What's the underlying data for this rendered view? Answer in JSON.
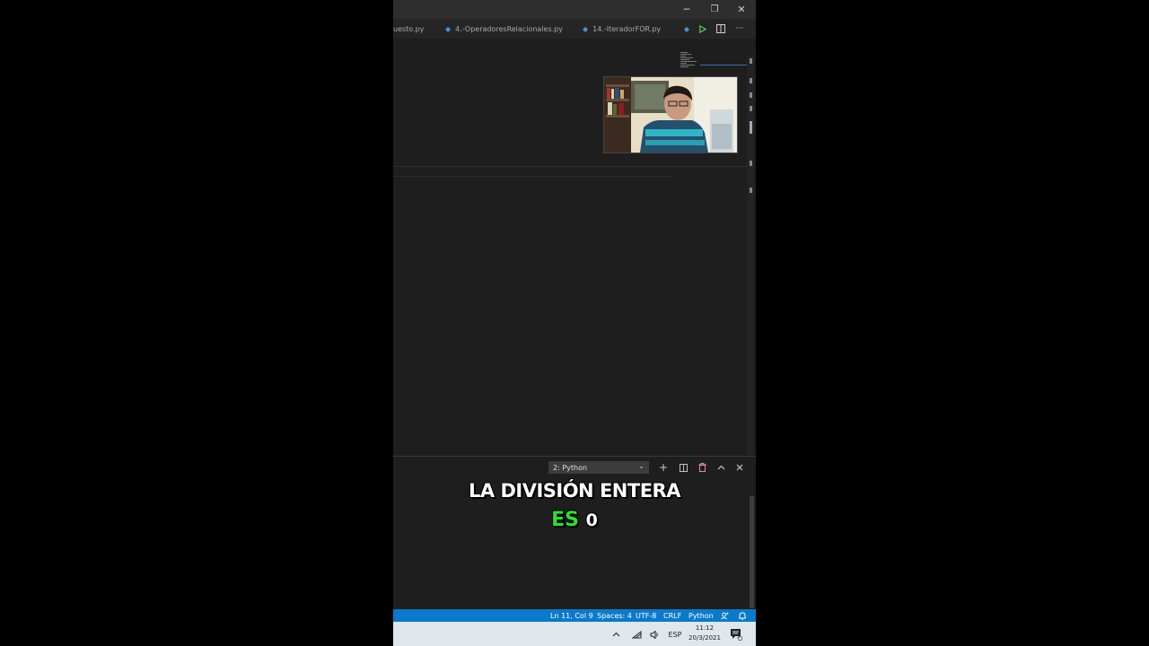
{
  "window": {
    "minimize_glyph": "─",
    "restore_glyph": "❐",
    "close_glyph": "✕"
  },
  "tabs": [
    {
      "label": "uesto.py"
    },
    {
      "label": "4.-OperadoresRelacionales.py"
    },
    {
      "label": "14.-IteradorFOR.py"
    }
  ],
  "toolbar": {
    "icons": [
      "python-file-icon",
      "run-icon",
      "split-editor-icon",
      "more-icon"
    ],
    "more_glyph": "···"
  },
  "panel": {
    "terminal_selected": "2: Python",
    "icons": [
      "add-terminal-icon",
      "split-terminal-icon",
      "trash-icon",
      "maximize-icon",
      "close-icon"
    ]
  },
  "captions": {
    "line1": "LA DIVISIÓN ENTERA",
    "line2_highlight": "ES",
    "line2_rest": "0"
  },
  "status": {
    "position": "Ln 11, Col 9",
    "spaces": "Spaces: 4",
    "encoding": "UTF-8",
    "eol": "CRLF",
    "language": "Python"
  },
  "taskbar": {
    "input_language": "ESP",
    "time": "11:12",
    "date": "20/3/2021",
    "notification_count": "5"
  },
  "colors": {
    "status_bar": "#0a7acc",
    "caption_highlight": "#2fe02f",
    "python_icon": "#4a8fd1",
    "run_icon": "#4ec94e",
    "trash_icon": "#e58aa8"
  }
}
